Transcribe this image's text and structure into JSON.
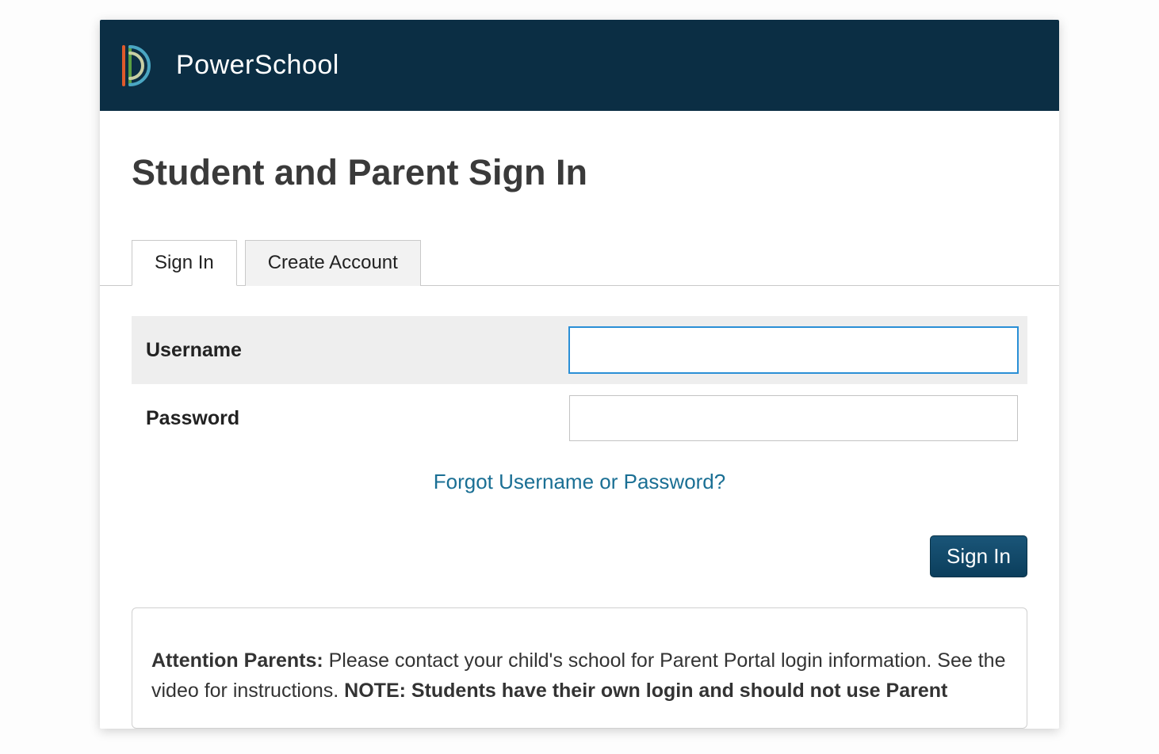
{
  "header": {
    "brand": "PowerSchool"
  },
  "page": {
    "title": "Student and Parent Sign In"
  },
  "tabs": {
    "signin": "Sign In",
    "create": "Create Account"
  },
  "form": {
    "username_label": "Username",
    "username_value": "",
    "password_label": "Password",
    "password_value": "",
    "forgot_link": "Forgot Username or Password?",
    "signin_button": "Sign In"
  },
  "notice": {
    "lead_bold": "Attention Parents: ",
    "lead_text": "Please contact your child's school for Parent Portal login information. See the video for instructions. ",
    "note_bold": "NOTE: Students have their own login and should not use Parent"
  }
}
